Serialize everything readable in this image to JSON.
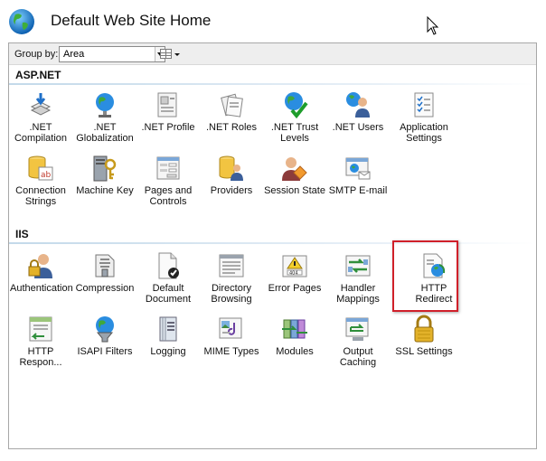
{
  "window": {
    "title": "Default Web Site Home"
  },
  "toolbar": {
    "group_by_label": "Group by:",
    "group_by_value": "Area"
  },
  "groups": [
    {
      "name": "ASP.NET",
      "items": [
        {
          "label": ".NET Compilation",
          "icon": "dotnet-compilation-icon"
        },
        {
          "label": ".NET Globalization",
          "icon": "dotnet-globalization-icon"
        },
        {
          "label": ".NET Profile",
          "icon": "dotnet-profile-icon"
        },
        {
          "label": ".NET Roles",
          "icon": "dotnet-roles-icon"
        },
        {
          "label": ".NET Trust Levels",
          "icon": "dotnet-trust-levels-icon"
        },
        {
          "label": ".NET Users",
          "icon": "dotnet-users-icon"
        },
        {
          "label": "Application Settings",
          "icon": "application-settings-icon"
        },
        {
          "label": "Connection Strings",
          "icon": "connection-strings-icon"
        },
        {
          "label": "Machine Key",
          "icon": "machine-key-icon"
        },
        {
          "label": "Pages and Controls",
          "icon": "pages-and-controls-icon"
        },
        {
          "label": "Providers",
          "icon": "providers-icon"
        },
        {
          "label": "Session State",
          "icon": "session-state-icon"
        },
        {
          "label": "SMTP E-mail",
          "icon": "smtp-email-icon"
        }
      ]
    },
    {
      "name": "IIS",
      "items": [
        {
          "label": "Authentication",
          "icon": "authentication-icon"
        },
        {
          "label": "Compression",
          "icon": "compression-icon"
        },
        {
          "label": "Default Document",
          "icon": "default-document-icon"
        },
        {
          "label": "Directory Browsing",
          "icon": "directory-browsing-icon"
        },
        {
          "label": "Error Pages",
          "icon": "error-pages-icon"
        },
        {
          "label": "Handler Mappings",
          "icon": "handler-mappings-icon"
        },
        {
          "label": "HTTP Redirect",
          "icon": "http-redirect-icon",
          "highlighted": true
        },
        {
          "label": "HTTP Respon...",
          "icon": "http-response-headers-icon"
        },
        {
          "label": "ISAPI Filters",
          "icon": "isapi-filters-icon"
        },
        {
          "label": "Logging",
          "icon": "logging-icon"
        },
        {
          "label": "MIME Types",
          "icon": "mime-types-icon"
        },
        {
          "label": "Modules",
          "icon": "modules-icon"
        },
        {
          "label": "Output Caching",
          "icon": "output-caching-icon"
        },
        {
          "label": "SSL Settings",
          "icon": "ssl-settings-icon"
        }
      ]
    }
  ],
  "colors": {
    "highlight_border": "#d0202a",
    "group_line": "#c3d9ea"
  }
}
